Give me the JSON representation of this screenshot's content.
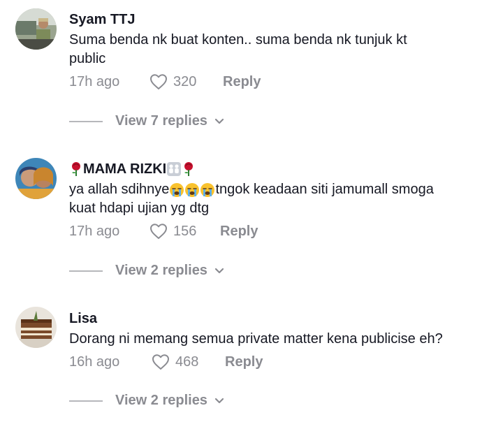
{
  "comments": [
    {
      "username": "Syam TTJ",
      "text_line1": "Suma benda nk buat konten.. suma benda nk tunjuk kt",
      "text_line2": "public",
      "time": "17h ago",
      "likes": "320",
      "reply_label": "Reply",
      "view_replies": "View 7 replies"
    },
    {
      "username": "MAMA RIZKI",
      "text_part1": "ya allah sdihnye",
      "text_part2": "tngok keadaan siti jamumall smoga",
      "text_line2": "kuat hdapi ujian yg dtg",
      "time": "17h ago",
      "likes": "156",
      "reply_label": "Reply",
      "view_replies": "View 2 replies"
    },
    {
      "username": "Lisa",
      "text_line1": "Dorang ni memang semua private matter kena publicise eh?",
      "time": "16h ago",
      "likes": "468",
      "reply_label": "Reply",
      "view_replies": "View 2 replies"
    }
  ],
  "colors": {
    "text": "#161823",
    "muted": "#8a8b91",
    "divider": "#b6b7bb"
  },
  "icons": {
    "like": "heart-outline-icon",
    "expand": "chevron-down-icon",
    "rose": "rose-emoji",
    "family": "family-emoji",
    "crying": "loudly-crying-face-emoji"
  }
}
